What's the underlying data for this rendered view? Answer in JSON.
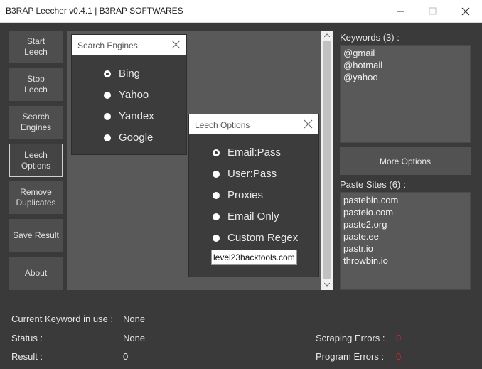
{
  "window": {
    "title": "B3RAP Leecher v0.4.1 | B3RAP SOFTWARES"
  },
  "nav": {
    "start": "Start\nLeech",
    "stop": "Stop\nLeech",
    "search": "Search\nEngines",
    "leech": "Leech\nOptions",
    "remove": "Remove\nDuplicates",
    "save": "Save Result",
    "about": "About"
  },
  "search_panel": {
    "title": "Search Engines",
    "options": [
      "Bing",
      "Yahoo",
      "Yandex",
      "Google"
    ],
    "selected": "Bing"
  },
  "leech_panel": {
    "title": "Leech Options",
    "options": [
      "Email:Pass",
      "User:Pass",
      "Proxies",
      "Email Only",
      "Custom Regex"
    ],
    "selected": "Email:Pass",
    "regex_value": "level23hacktools.com"
  },
  "keywords": {
    "label": "Keywords (3) :",
    "items": [
      "@gmail",
      "@hotmail",
      "@yahoo"
    ]
  },
  "more_options": "More Options",
  "paste_sites": {
    "label": "Paste Sites (6) :",
    "items": [
      "pastebin.com",
      "pasteio.com",
      "paste2.org",
      "paste.ee",
      "pastr.io",
      "throwbin.io"
    ]
  },
  "status": {
    "keyword_label": "Current Keyword in use :",
    "keyword_value": "None",
    "status_label": "Status :",
    "status_value": "None",
    "result_label": "Result :",
    "result_value": "0",
    "scraping_label": "Scraping Errors :",
    "scraping_value": "0",
    "program_label": "Program Errors :",
    "program_value": "0"
  },
  "colors": {
    "background": "#3a3a3a",
    "error": "#e02020"
  }
}
